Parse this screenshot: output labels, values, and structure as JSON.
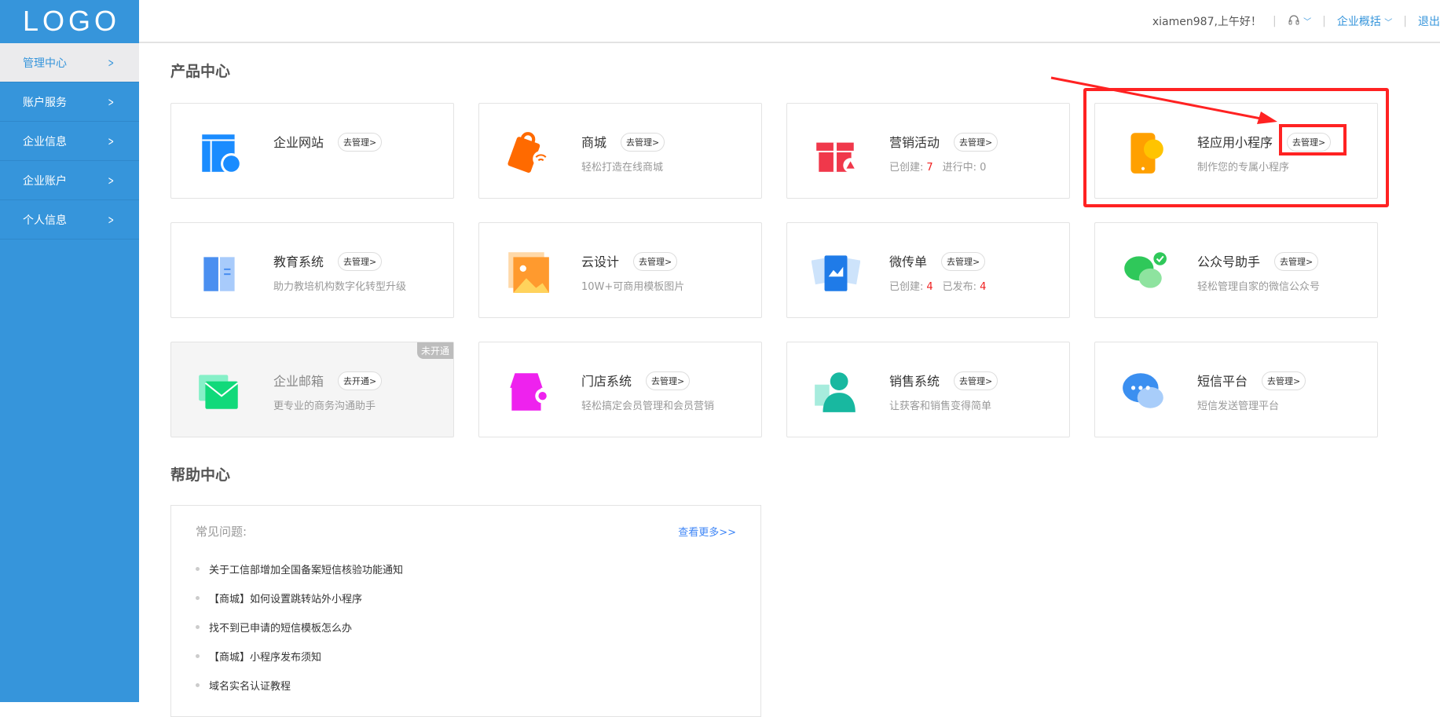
{
  "logo": "LOGO",
  "sidebar": {
    "items": [
      {
        "label": "管理中心",
        "active": true
      },
      {
        "label": "账户服务"
      },
      {
        "label": "企业信息"
      },
      {
        "label": "企业账户"
      },
      {
        "label": "个人信息"
      }
    ]
  },
  "header": {
    "greeting": "xiamen987,上午好！",
    "overview": "企业概括",
    "logout": "退出"
  },
  "products": {
    "title": "产品中心",
    "cards": [
      {
        "title": "企业网站",
        "button": "去管理>",
        "icon": "website-icon",
        "color": "#1a8cff"
      },
      {
        "title": "商城",
        "button": "去管理>",
        "sub": "轻松打造在线商城",
        "icon": "shopping-bag-icon",
        "color": "#ff6a00"
      },
      {
        "title": "营销活动",
        "button": "去管理>",
        "stats": [
          {
            "label": "已创建:",
            "value": "7"
          },
          {
            "label": "进行中:",
            "value": "0",
            "plain": true
          }
        ],
        "icon": "gift-icon",
        "color": "#f0384b"
      },
      {
        "title": "轻应用小程序",
        "button": "去管理>",
        "sub": "制作您的专属小程序",
        "icon": "mini-program-phone-icon",
        "color": "#ffa000"
      },
      {
        "title": "教育系统",
        "button": "去管理>",
        "sub": "助力教培机构数字化转型升级",
        "icon": "book-icon",
        "color": "#4a8ff0"
      },
      {
        "title": "云设计",
        "button": "去管理>",
        "sub": "10W+可商用模板图片",
        "icon": "image-icon",
        "color": "#ff9a2e"
      },
      {
        "title": "微传单",
        "button": "去管理>",
        "stats": [
          {
            "label": "已创建:",
            "value": "4"
          },
          {
            "label": "已发布:",
            "value": "4"
          }
        ],
        "icon": "flyer-icon",
        "color": "#1f7be8"
      },
      {
        "title": "公众号助手",
        "button": "去管理>",
        "sub": "轻松管理自家的微信公众号",
        "icon": "wechat-icon",
        "color": "#2fc85a"
      },
      {
        "title": "企业邮箱",
        "button": "去开通>",
        "sub": "更专业的商务沟通助手",
        "badge": "未开通",
        "disabled": true,
        "icon": "mail-icon",
        "color": "#11d97a"
      },
      {
        "title": "门店系统",
        "button": "去管理>",
        "sub": "轻松搞定会员管理和会员营销",
        "icon": "store-icon",
        "color": "#ee22ee"
      },
      {
        "title": "销售系统",
        "button": "去管理>",
        "sub": "让获客和销售变得简单",
        "icon": "salesperson-icon",
        "color": "#18b8a0"
      },
      {
        "title": "短信平台",
        "button": "去管理>",
        "sub": "短信发送管理平台",
        "icon": "sms-chat-icon",
        "color": "#3b8ff0"
      }
    ]
  },
  "help": {
    "title": "帮助中心",
    "faq_label": "常见问题:",
    "more": "查看更多>>",
    "items": [
      "关于工信部增加全国备案短信核验功能通知",
      "【商城】如何设置跳转站外小程序",
      "找不到已申请的短信模板怎么办",
      "【商城】小程序发布须知",
      "域名实名认证教程"
    ]
  }
}
